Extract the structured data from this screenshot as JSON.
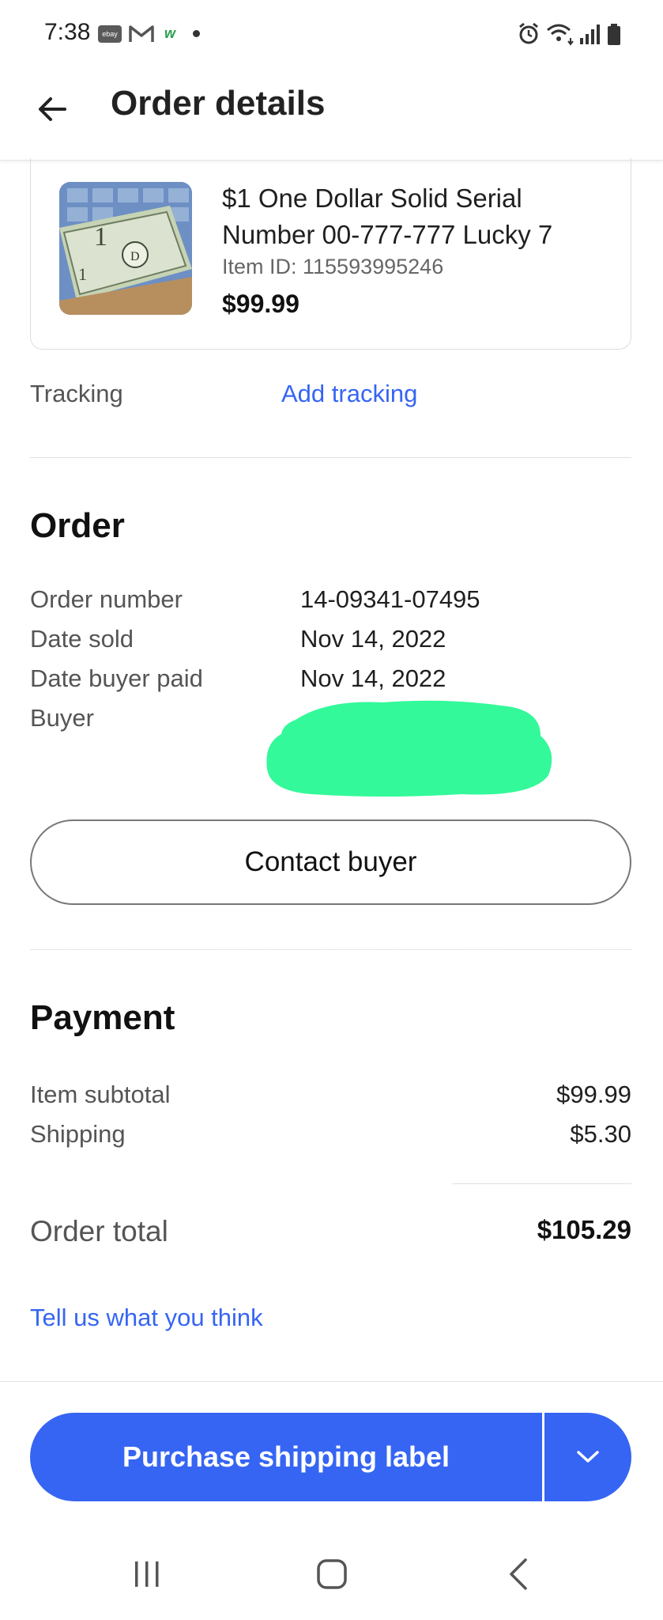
{
  "status_bar": {
    "time": "7:38",
    "ebay_badge": "ebay",
    "w_badge": "w",
    "icons": [
      "ebay-icon",
      "gmail-icon",
      "w-app-icon",
      "notification-dot-icon",
      "alarm-icon",
      "wifi-icon",
      "signal-icon",
      "battery-icon"
    ]
  },
  "header": {
    "title": "Order details",
    "back_icon": "arrow-left-icon"
  },
  "item": {
    "title": "$1 One Dollar Solid Serial Number 00-777-777 Lucky 7",
    "item_id": "Item ID: 115593995246",
    "price": "$99.99"
  },
  "tracking": {
    "label": "Tracking",
    "link": "Add tracking"
  },
  "order": {
    "title": "Order",
    "rows": [
      {
        "label": "Order number",
        "value": "14-09341-07495"
      },
      {
        "label": "Date sold",
        "value": "Nov 14, 2022"
      },
      {
        "label": "Date buyer paid",
        "value": "Nov 14, 2022"
      },
      {
        "label": "Buyer",
        "value": ""
      }
    ],
    "contact_button": "Contact buyer",
    "redaction_color": "#33f99a"
  },
  "payment": {
    "title": "Payment",
    "rows": [
      {
        "label": "Item subtotal",
        "value": "$99.99"
      },
      {
        "label": "Shipping",
        "value": "$5.30"
      }
    ],
    "total_label": "Order total",
    "total_value": "$105.29"
  },
  "feedback_link": "Tell us what you think",
  "actions": {
    "purchase_label": "Purchase shipping label",
    "dropdown_icon": "chevron-down-icon",
    "accent_color": "#3665f3"
  },
  "nav_bar": {
    "icons": [
      "recent-apps-icon",
      "home-icon",
      "back-icon"
    ]
  }
}
